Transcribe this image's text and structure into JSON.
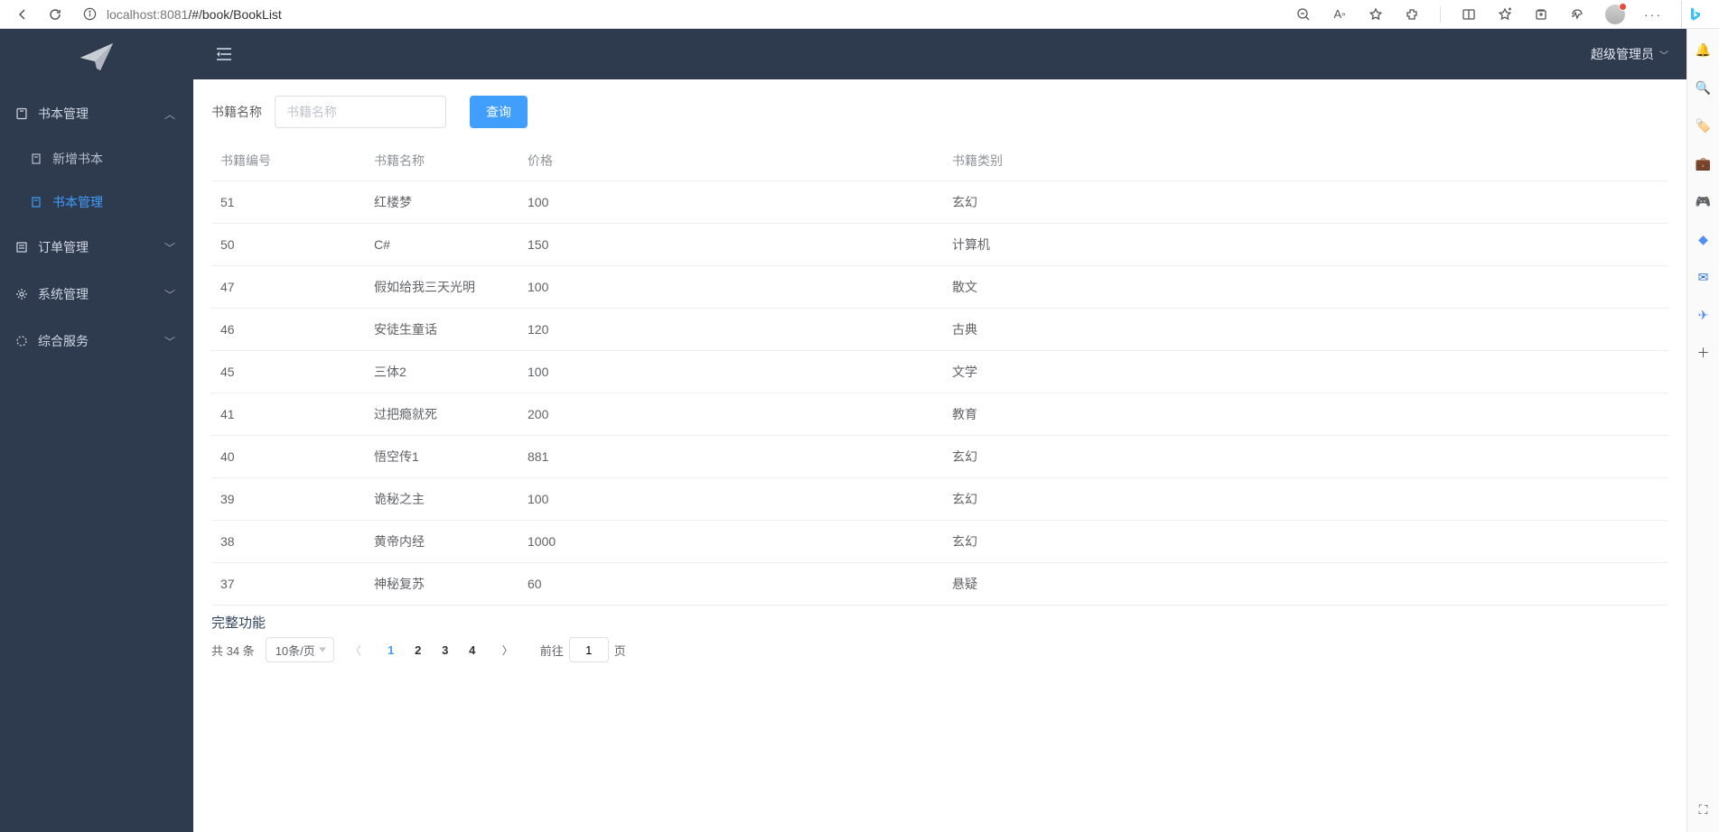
{
  "browser": {
    "url_host": "localhost",
    "url_port": ":8081",
    "url_path": "/#/book/BookList"
  },
  "sidebar": {
    "items": [
      {
        "label": "书本管理",
        "expanded": true
      },
      {
        "label": "订单管理",
        "expanded": false
      },
      {
        "label": "系统管理",
        "expanded": false
      },
      {
        "label": "综合服务",
        "expanded": false
      }
    ],
    "submenu0": [
      {
        "label": "新增书本",
        "active": false
      },
      {
        "label": "书本管理",
        "active": true
      }
    ]
  },
  "header": {
    "user_label": "超级管理员"
  },
  "search": {
    "label": "书籍名称",
    "placeholder": "书籍名称",
    "button": "查询"
  },
  "table": {
    "headers": {
      "id": "书籍编号",
      "name": "书籍名称",
      "price": "价格",
      "category": "书籍类别"
    },
    "rows": [
      {
        "id": "51",
        "name": "红楼梦",
        "price": "100",
        "category": "玄幻"
      },
      {
        "id": "50",
        "name": "C#",
        "price": "150",
        "category": "计算机"
      },
      {
        "id": "47",
        "name": "假如给我三天光明",
        "price": "100",
        "category": "散文"
      },
      {
        "id": "46",
        "name": "安徒生童话",
        "price": "120",
        "category": "古典"
      },
      {
        "id": "45",
        "name": "三体2",
        "price": "100",
        "category": "文学"
      },
      {
        "id": "41",
        "name": "过把瘾就死",
        "price": "200",
        "category": "教育"
      },
      {
        "id": "40",
        "name": "悟空传1",
        "price": "881",
        "category": "玄幻"
      },
      {
        "id": "39",
        "name": "诡秘之主",
        "price": "100",
        "category": "玄幻"
      },
      {
        "id": "38",
        "name": "黄帝内经",
        "price": "1000",
        "category": "玄幻"
      },
      {
        "id": "37",
        "name": "神秘复苏",
        "price": "60",
        "category": "悬疑"
      }
    ]
  },
  "footer": {
    "title": "完整功能",
    "total_text": "共 34 条",
    "page_size": "10条/页",
    "pages": [
      "1",
      "2",
      "3",
      "4"
    ],
    "active_page": "1",
    "goto_prefix": "前往",
    "goto_value": "1",
    "goto_suffix": "页"
  }
}
